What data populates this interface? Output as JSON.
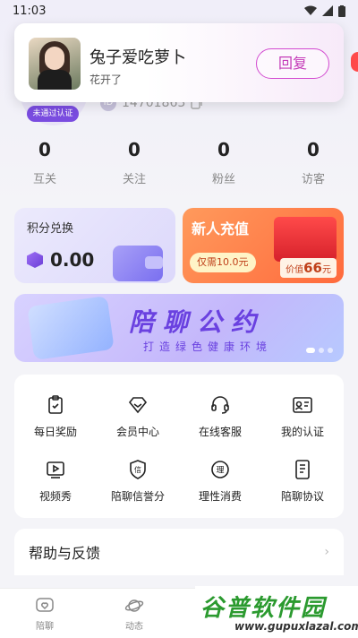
{
  "status_bar": {
    "time": "11:03"
  },
  "notification": {
    "name": "兔子爱吃萝卜",
    "message": "花开了",
    "reply_label": "回复"
  },
  "profile": {
    "badge": "未通过认证",
    "uid": "14701863"
  },
  "stats": [
    {
      "value": "0",
      "label": "互关"
    },
    {
      "value": "0",
      "label": "关注"
    },
    {
      "value": "0",
      "label": "粉丝"
    },
    {
      "value": "0",
      "label": "访客"
    }
  ],
  "points_card": {
    "title": "积分兑换",
    "amount": "0.00"
  },
  "recharge_card": {
    "title": "新人充值",
    "price_label": "仅需10.0元",
    "value_prefix": "价值",
    "value_amount": "66",
    "value_suffix": "元"
  },
  "banner": {
    "title": "陪聊公约",
    "subtitle": "打造绿色健康环境"
  },
  "grid_items": [
    {
      "label": "每日奖励",
      "icon": "clipboard-check-icon"
    },
    {
      "label": "会员中心",
      "icon": "diamond-icon"
    },
    {
      "label": "在线客服",
      "icon": "headset-icon"
    },
    {
      "label": "我的认证",
      "icon": "id-card-icon"
    },
    {
      "label": "视频秀",
      "icon": "video-play-icon"
    },
    {
      "label": "陪聊信誉分",
      "icon": "shield-credit-icon"
    },
    {
      "label": "理性消费",
      "icon": "coin-icon"
    },
    {
      "label": "陪聊协议",
      "icon": "document-icon"
    }
  ],
  "help": {
    "label": "帮助与反馈"
  },
  "tabbar": [
    {
      "label": "陪聊",
      "icon": "heart-chat-icon"
    },
    {
      "label": "动态",
      "icon": "planet-icon"
    }
  ],
  "watermark": {
    "title": "谷普软件园",
    "url": "www.gupuxlazal.com"
  },
  "colors": {
    "accent": "#6a41e0",
    "reply": "#c43bb8",
    "recharge": "#ff6a3d"
  }
}
